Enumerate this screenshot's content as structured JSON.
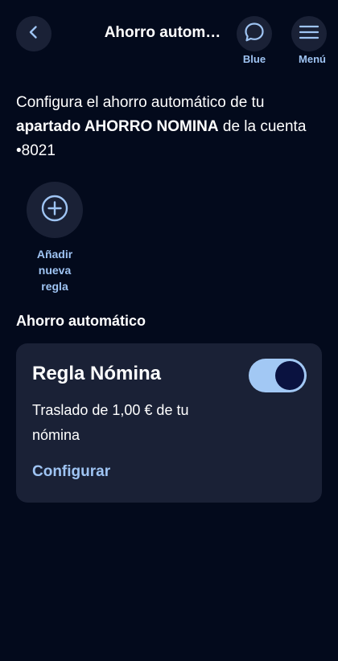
{
  "header": {
    "title": "Ahorro autom…",
    "blue_label": "Blue",
    "menu_label": "Menú"
  },
  "intro": {
    "prefix": "Configura el ahorro automático de tu ",
    "bold": "apartado AHORRO NOMINA",
    "suffix": " de la cuenta •8021"
  },
  "add_rule": {
    "line1": "Añadir",
    "line2": "nueva",
    "line3": "regla"
  },
  "section": {
    "title": "Ahorro automático"
  },
  "rule_card": {
    "title": "Regla Nómina",
    "toggle_on": true,
    "description": "Traslado de 1,00 € de tu nómina",
    "link": "Configurar"
  },
  "colors": {
    "background": "#030a1c",
    "surface": "#1a2136",
    "accent": "#9fc4f3",
    "toggle_track": "#a2c8f4",
    "toggle_knob": "#0a1240"
  },
  "icons": {
    "back": "chevron-left-icon",
    "blue": "chat-bubble-icon",
    "menu": "hamburger-menu-icon",
    "add": "plus-circle-icon"
  }
}
